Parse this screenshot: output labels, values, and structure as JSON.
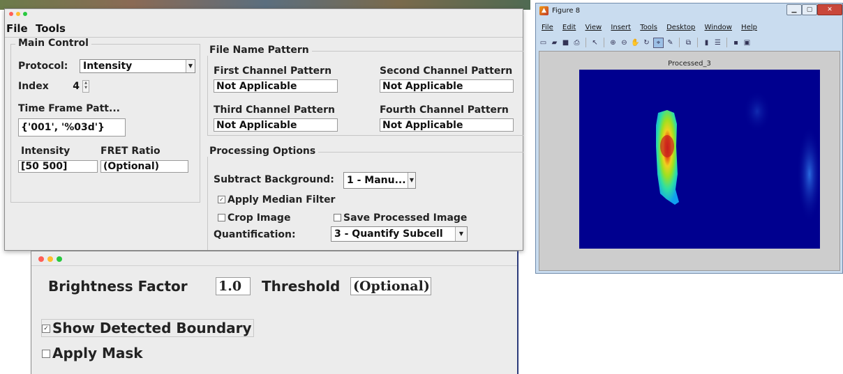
{
  "main_window": {
    "menu": {
      "file": "File",
      "tools": "Tools"
    },
    "main_control": {
      "legend": "Main Control",
      "protocol_label": "Protocol:",
      "protocol_value": "Intensity",
      "index_label": "Index",
      "index_value": "4",
      "time_frame_label": "Time Frame Patt...",
      "time_frame_value": "{'001', '%03d'}",
      "intensity_label": "Intensity",
      "intensity_value": "[50 500]",
      "fret_label": "FRET Ratio",
      "fret_value": "(Optional)"
    },
    "file_name_pattern": {
      "legend": "File Name Pattern",
      "first_label": "First Channel Pattern",
      "first_value": "Not Applicable",
      "second_label": "Second Channel Pattern",
      "second_value": "Not Applicable",
      "third_label": "Third Channel Pattern",
      "third_value": "Not Applicable",
      "fourth_label": "Fourth Channel Pattern",
      "fourth_value": "Not Applicable"
    },
    "processing_options": {
      "legend": "Processing Options",
      "subtract_label": "Subtract Background:",
      "subtract_value": "1 - Manu...",
      "median_label": "Apply Median Filter",
      "median_checked": true,
      "crop_label": "Crop Image",
      "crop_checked": false,
      "save_label": "Save Processed Image",
      "save_checked": false,
      "quant_label": "Quantification:",
      "quant_value": "3 - Quantify Subcell"
    }
  },
  "second_window": {
    "brightness_label": "Brightness Factor",
    "brightness_value": "1.0",
    "threshold_label": "Threshold",
    "threshold_value": "(Optional)",
    "show_boundary_label": "Show Detected Boundary",
    "show_boundary_checked": true,
    "apply_mask_label": "Apply Mask",
    "apply_mask_checked": false
  },
  "figure_window": {
    "title": "Figure 8",
    "menu": [
      "File",
      "Edit",
      "View",
      "Insert",
      "Tools",
      "Desktop",
      "Window",
      "Help"
    ],
    "axes_title": "Processed_3"
  },
  "colors": {
    "window_bg": "#ececec",
    "image_bg": "#00008f",
    "figure_frame": "#c9dcef"
  }
}
